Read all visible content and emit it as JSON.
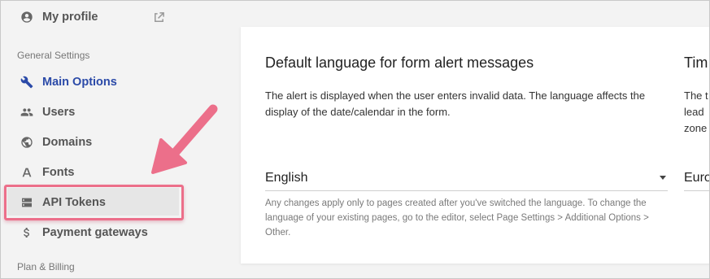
{
  "sidebar": {
    "my_profile": "My profile",
    "section_general": "General Settings",
    "items": [
      {
        "label": "Main Options",
        "icon": "wrench-icon"
      },
      {
        "label": "Users",
        "icon": "users-icon"
      },
      {
        "label": "Domains",
        "icon": "globe-icon"
      },
      {
        "label": "Fonts",
        "icon": "font-icon"
      },
      {
        "label": "API Tokens",
        "icon": "server-icon"
      },
      {
        "label": "Payment gateways",
        "icon": "dollar-icon"
      }
    ],
    "section_billing": "Plan & Billing"
  },
  "main": {
    "language_title": "Default language for form alert messages",
    "language_desc": "The alert is displayed when the user enters invalid data. The language affects the display of the date/calendar in the form.",
    "language_value": "English",
    "language_hint": "Any changes apply only to pages created after you've switched the language. To change the language of your existing pages, go to the editor, select Page Settings > Additional Options > Other.",
    "timezone_title_partial": "Tim",
    "timezone_desc_partial": "The t\nlead \nzone",
    "timezone_value_partial": "Euro"
  },
  "colors": {
    "accent": "#2b4aa8",
    "highlight": "#ec6f8a"
  }
}
